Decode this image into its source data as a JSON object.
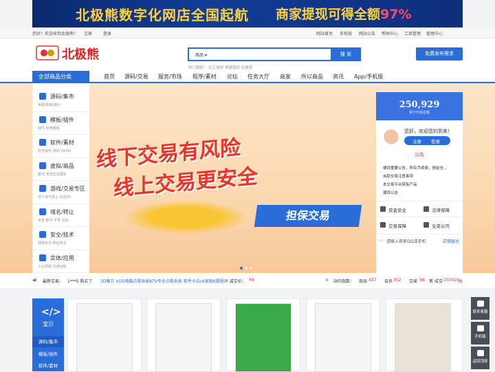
{
  "banner": {
    "left_text": "北极熊数字化网店全国起航",
    "right_prefix": "商家提现可得全额",
    "right_highlight": "97%"
  },
  "topbar": {
    "welcome": "您好！欢迎来到北极熊！",
    "register": "注册",
    "login": "登录",
    "links": [
      "网站首页",
      "手机版",
      "网站公告",
      "帮助中心",
      "工单管理",
      "管理中心"
    ]
  },
  "logo": {
    "text": "北极熊"
  },
  "search": {
    "category": "商品",
    "button": "搜 索",
    "hot_label": "热门搜索：",
    "hot_words": [
      "任正装修",
      "神器镜目",
      "红楼梦"
    ]
  },
  "publish_button": "免费发布需求",
  "nav": {
    "category_button": "全部商品分类",
    "items": [
      "首页",
      "源码/交易",
      "服务/市场",
      "程序/素材",
      "论坛",
      "任务大厅",
      "商家",
      "所以商品",
      "资讯",
      "App/手机版"
    ]
  },
  "categories": [
    {
      "title": "源码/集市",
      "sub": "美图|图库|图片"
    },
    {
      "title": "模板/插件",
      "sub": "插件  应用模板"
    },
    {
      "title": "软件/素材",
      "sub": "软件程序  游戏  VR/AR"
    },
    {
      "title": "虚拟/商品",
      "sub": "图书  本地生活服务"
    },
    {
      "title": "游戏/交易专区",
      "sub": "地下城与勇士  征途2S"
    },
    {
      "title": "域名/转让",
      "sub": "拼音  数字  字母  混杂"
    },
    {
      "title": "安全/技术",
      "sub": "网络安全  移动安全"
    },
    {
      "title": "实体/应用",
      "sub": "工业领域  交通运输"
    }
  ],
  "hero": {
    "line1": "线下交易有风险",
    "line2": "线上交易更安全",
    "cta": "担保交易"
  },
  "panel": {
    "stat_value": "250,929",
    "stat_label": "累计交易总额",
    "greeting": "您好，欢迎您的到来！",
    "register": "注册",
    "login": "登录",
    "announce_title": "公告",
    "notices": [
      "捷现重要公告，所有手续费，佣金全...",
      "自助交易注意事项",
      "本交易平台禁售产品",
      "捷现公告"
    ],
    "buttons": [
      "资金安全",
      "法律保障",
      "交易保障",
      "全资公司"
    ],
    "qq_placeholder": "请输入商家QQ或手机",
    "qq_button": "店铺直达"
  },
  "ticker": {
    "label": "最新交易：",
    "buyer": "1***5 购买了",
    "item": "3D魔方 VOD电脑点歌系统KTV专业点歌系统 软件卡拉ok家庭K歌程序...",
    "done_label": "成交价：",
    "price": "¥8",
    "index_label": "站内指数：",
    "goods_label": "商品",
    "goods": "437",
    "members_label": "会员",
    "members": "352",
    "trades_label": "交易",
    "trades": "98",
    "trades_unit": "笔",
    "total_label": "成交",
    "total": "250929",
    "total_unit": "元"
  },
  "showcase": {
    "title": "宝贝",
    "tabs": [
      "源码/集市",
      "模板/插件",
      "软件/素材"
    ]
  },
  "side": {
    "items": [
      "联系客服",
      "手机版",
      "返回顶部"
    ]
  }
}
